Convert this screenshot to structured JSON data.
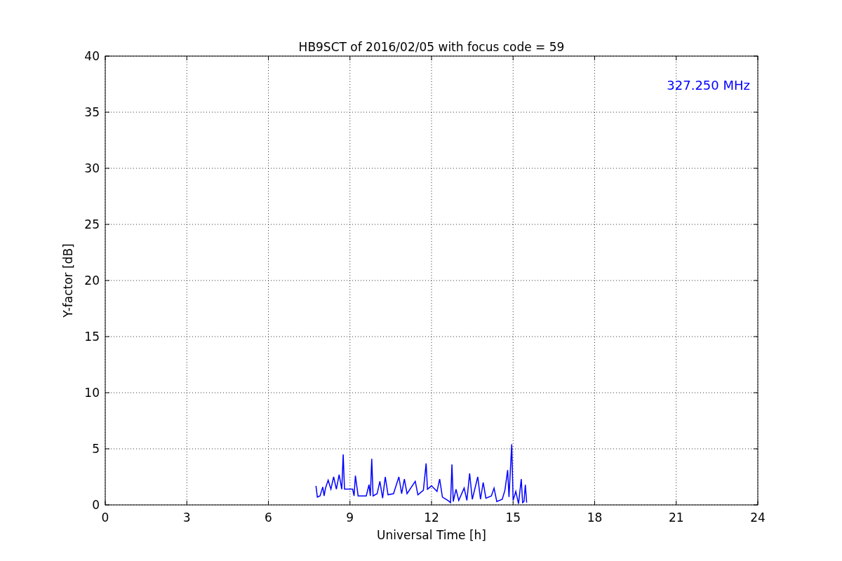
{
  "chart_data": {
    "type": "line",
    "title": "HB9SCT of 2016/02/05 with focus code = 59",
    "xlabel": "Universal Time [h]",
    "ylabel": "Y-factor [dB]",
    "xlim": [
      0,
      24
    ],
    "ylim": [
      0,
      40
    ],
    "xticks": [
      0,
      3,
      6,
      9,
      12,
      15,
      18,
      21,
      24
    ],
    "yticks": [
      0,
      5,
      10,
      15,
      20,
      25,
      30,
      35,
      40
    ],
    "x": [
      7.75,
      7.8,
      7.9,
      8.0,
      8.05,
      8.1,
      8.2,
      8.3,
      8.4,
      8.5,
      8.6,
      8.7,
      8.75,
      8.8,
      9.0,
      9.1,
      9.15,
      9.2,
      9.3,
      9.6,
      9.7,
      9.75,
      9.8,
      9.85,
      10.0,
      10.1,
      10.2,
      10.3,
      10.4,
      10.6,
      10.8,
      10.9,
      11.0,
      11.1,
      11.4,
      11.5,
      11.7,
      11.8,
      11.85,
      12.0,
      12.2,
      12.3,
      12.4,
      12.6,
      12.7,
      12.75,
      12.8,
      12.9,
      13.0,
      13.2,
      13.3,
      13.4,
      13.5,
      13.7,
      13.8,
      13.9,
      14.0,
      14.2,
      14.3,
      14.4,
      14.6,
      14.7,
      14.8,
      14.85,
      14.95,
      15.0,
      15.1,
      15.2,
      15.3,
      15.35,
      15.4,
      15.45,
      15.5
    ],
    "series": [
      {
        "color": "#0000ff",
        "values": [
          1.7,
          0.7,
          0.8,
          1.6,
          0.8,
          1.5,
          2.2,
          1.4,
          2.5,
          1.4,
          2.7,
          1.4,
          4.5,
          1.4,
          1.4,
          1.4,
          0.8,
          2.6,
          0.8,
          0.8,
          1.8,
          0.8,
          4.1,
          0.8,
          1.0,
          2.1,
          0.6,
          2.5,
          0.9,
          1.0,
          2.5,
          1.0,
          2.3,
          1.0,
          2.1,
          0.9,
          1.3,
          3.7,
          1.4,
          1.7,
          1.2,
          2.3,
          0.7,
          0.4,
          0.2,
          3.6,
          0.3,
          1.4,
          0.4,
          1.5,
          0.4,
          2.8,
          0.5,
          2.5,
          0.5,
          2.0,
          0.6,
          0.8,
          1.5,
          0.3,
          0.5,
          1.3,
          3.1,
          0.7,
          5.4,
          0.4,
          1.2,
          0.1,
          2.3,
          0.2,
          0.3,
          1.8,
          0.2
        ]
      }
    ],
    "grid": true,
    "annotations": [
      {
        "text": "327.250 MHz"
      }
    ]
  }
}
